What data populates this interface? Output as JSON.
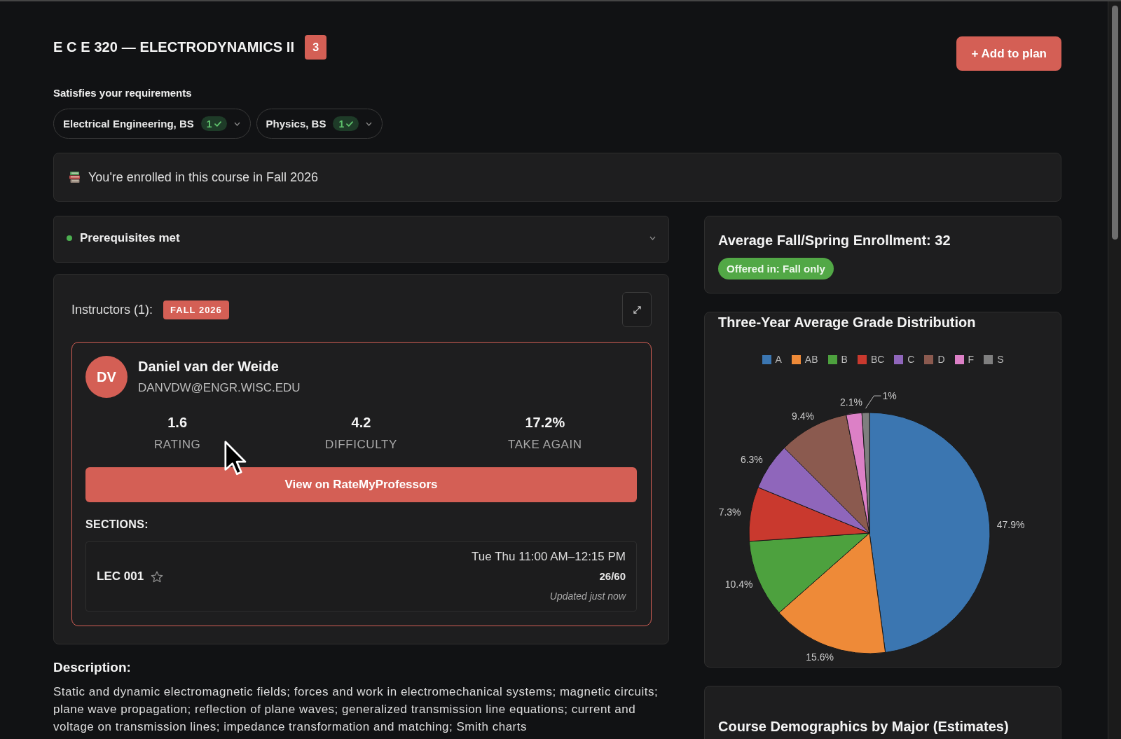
{
  "header": {
    "title": "E C E 320 — ELECTRODYNAMICS II",
    "credits": "3",
    "add_button": "+ Add to plan"
  },
  "requirements": {
    "heading": "Satisfies your requirements",
    "items": [
      {
        "label": "Electrical Engineering, BS",
        "count": "1",
        "expanded": false
      },
      {
        "label": "Physics, BS",
        "count": "1",
        "expanded": false
      }
    ]
  },
  "enrollment_notice": {
    "text": "You're enrolled in this course in Fall 2026"
  },
  "prerequisites": {
    "label": "Prerequisites met",
    "met": true,
    "expanded": false
  },
  "instructors": {
    "heading": "Instructors (1):",
    "term": "FALL 2026",
    "items": [
      {
        "initials": "DV",
        "name": "Daniel van der Weide",
        "email": "DANVDW@ENGR.WISC.EDU",
        "stats": [
          {
            "value": "1.6",
            "label": "RATING"
          },
          {
            "value": "4.2",
            "label": "DIFFICULTY"
          },
          {
            "value": "17.2%",
            "label": "TAKE AGAIN"
          }
        ],
        "ratings_button": "View on RateMyProfessors",
        "sections_heading": "SECTIONS:",
        "sections": [
          {
            "name": "LEC 001",
            "starred": false,
            "schedule": "Tue Thu 11:00 AM–12:15 PM",
            "seats": "26/60",
            "updated": "Updated just now"
          }
        ]
      }
    ]
  },
  "description": {
    "heading": "Description:",
    "text": "Static and dynamic electromagnetic fields; forces and work in electromechanical systems; magnetic circuits; plane wave propagation; reflection of plane waves; generalized transmission line equations; current and voltage on transmission lines; impedance transformation and matching; Smith charts"
  },
  "enrollment_stats": {
    "heading": "Average Fall/Spring Enrollment: 32",
    "offered": "Offered in: Fall only"
  },
  "grade_distribution": {
    "chart_data": {
      "type": "pie",
      "title": "Three-Year Average Grade Distribution",
      "legend": "top",
      "categories": [
        "A",
        "AB",
        "B",
        "BC",
        "C",
        "D",
        "F",
        "S"
      ],
      "values": [
        47.9,
        15.6,
        10.4,
        7.3,
        6.3,
        9.4,
        2.1,
        1
      ],
      "colors": [
        "#3b76b1",
        "#ee8a38",
        "#4da13e",
        "#c9392e",
        "#8f66bb",
        "#8b5a4f",
        "#dc80c6",
        "#7f7f7f"
      ],
      "value_labels": [
        "47.9%",
        "15.6%",
        "10.4%",
        "7.3%",
        "6.3%",
        "9.4%",
        "2.1%",
        "1%"
      ]
    }
  },
  "demographics": {
    "heading": "Course Demographics by Major (Estimates)"
  }
}
